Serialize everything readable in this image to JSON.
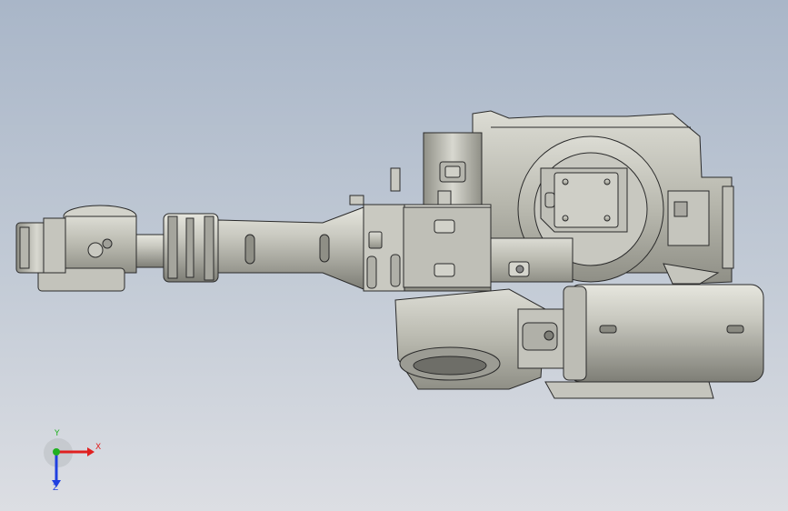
{
  "viewport": {
    "background_top": "#a9b6c8",
    "background_bottom": "#dcdee3",
    "model": {
      "description_icon": "robot-arm-cad-model",
      "body_color": "#bcbcb2",
      "edge_color": "#2a2a2a"
    }
  },
  "triad": {
    "x_label": "X",
    "y_label": "Y",
    "z_label": "Z",
    "x_color": "#e02020",
    "y_color": "#20b020",
    "z_color": "#2040e0"
  }
}
